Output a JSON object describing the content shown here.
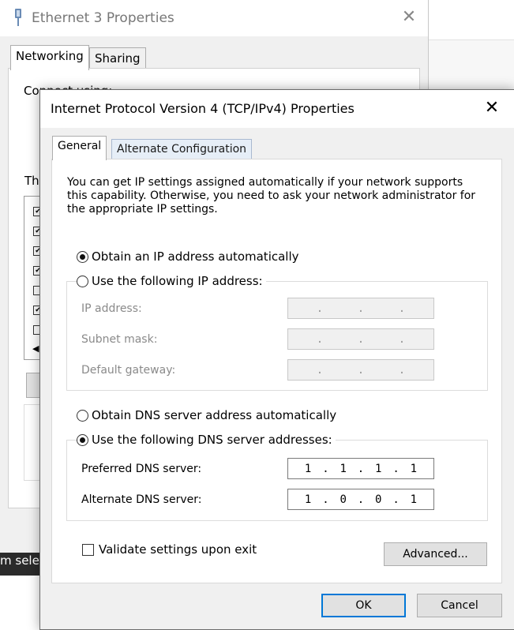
{
  "background_window": {
    "title": "Ethernet 3 Properties",
    "tabs": [
      "Networking",
      "Sharing"
    ],
    "partial_label_1": "Connect using:",
    "partial_label_2": "Th",
    "taskbar_text": "m selec"
  },
  "dialog": {
    "title": "Internet Protocol Version 4 (TCP/IPv4) Properties",
    "tabs": {
      "general": "General",
      "alternate": "Alternate Configuration"
    },
    "description": "You can get IP settings assigned automatically if your network supports this capability. Otherwise, you need to ask your network administrator for the appropriate IP settings.",
    "ip_mode": {
      "auto_label": "Obtain an IP address automatically",
      "manual_label": "Use the following IP address:",
      "selected": "auto"
    },
    "ip_fields": {
      "ip_address_label": "IP address:",
      "subnet_mask_label": "Subnet mask:",
      "gateway_label": "Default gateway:",
      "empty_value": ". . ."
    },
    "dns_mode": {
      "auto_label": "Obtain DNS server address automatically",
      "manual_label": "Use the following DNS server addresses:",
      "selected": "manual"
    },
    "dns_fields": {
      "preferred_label": "Preferred DNS server:",
      "preferred_octets": [
        "1",
        ".",
        "1",
        ".",
        "1",
        ".",
        "1"
      ],
      "alternate_label": "Alternate DNS server:",
      "alternate_octets": [
        "1",
        ".",
        "0",
        ".",
        "0",
        ".",
        "1"
      ]
    },
    "validate_label": "Validate settings upon exit",
    "validate_checked": false,
    "buttons": {
      "advanced": "Advanced...",
      "ok": "OK",
      "cancel": "Cancel"
    }
  },
  "colors": {
    "accent": "#0078d7",
    "dialog_bg": "#f0f0f0",
    "disabled_text": "#8a8a8a"
  }
}
